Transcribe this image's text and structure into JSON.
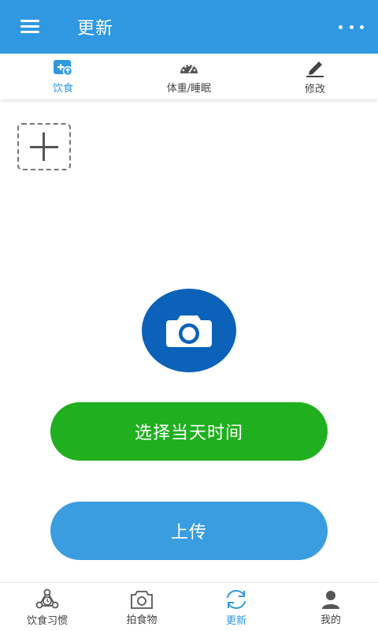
{
  "header": {
    "title": "更新",
    "menu_icon": "hamburger-menu-icon",
    "more_icon": "more-dots-icon",
    "bg_color": "#2f98e0"
  },
  "top_tabs": [
    {
      "label": "饮食",
      "icon": "diet-add-icon",
      "active": true
    },
    {
      "label": "体重/睡眠",
      "icon": "gauge-icon",
      "active": false
    },
    {
      "label": "修改",
      "icon": "edit-pencil-icon",
      "active": false
    }
  ],
  "add_photo": {
    "icon": "plus-icon"
  },
  "camera": {
    "icon": "camera-icon",
    "color": "#0c62b9"
  },
  "buttons": {
    "select_time": "选择当天时间",
    "upload": "上传",
    "green": "#1faf1f",
    "blue": "#3a9de0"
  },
  "bottom_nav": [
    {
      "label": "饮食习惯",
      "icon": "diet-habit-icon",
      "active": false
    },
    {
      "label": "拍食物",
      "icon": "camera-icon",
      "active": false
    },
    {
      "label": "更新",
      "icon": "refresh-icon",
      "active": true
    },
    {
      "label": "我的",
      "icon": "user-icon",
      "active": false
    }
  ]
}
